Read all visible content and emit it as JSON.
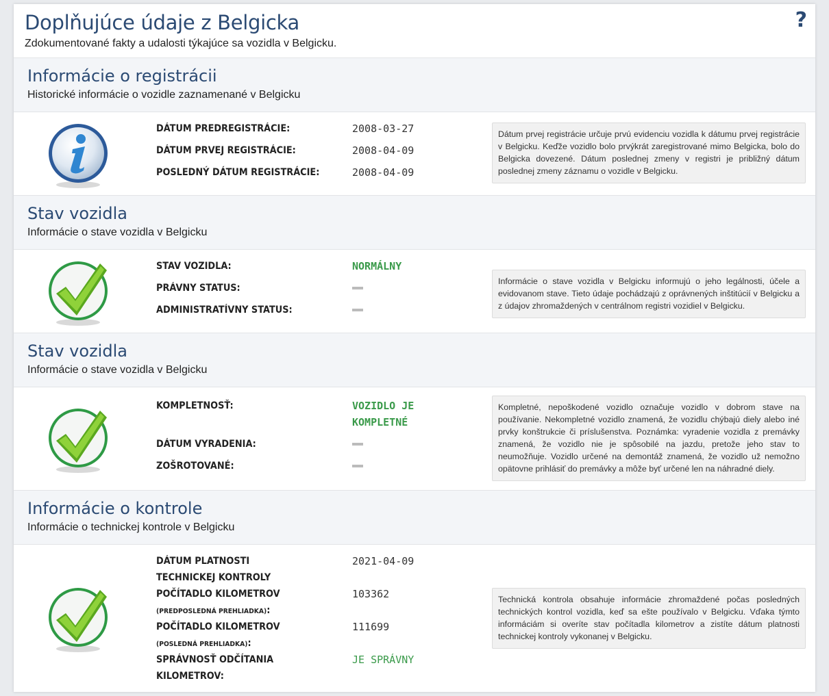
{
  "header": {
    "title": "Doplňujúce údaje z Belgicka",
    "subtitle": "Zdokumentované fakty a udalosti týkajúce sa vozidla v Belgicku.",
    "help": "?"
  },
  "sections": [
    {
      "title": "Informácie o registrácii",
      "subtitle": "Historické informácie o vozidle zaznamenané v Belgicku",
      "icon": "info-icon",
      "rows": [
        {
          "label": "DÁTUM PREDREGISTRÁCIE:",
          "value": "2008-03-27"
        },
        {
          "label": "DÁTUM PRVEJ REGISTRÁCIE:",
          "value": "2008-04-09"
        },
        {
          "label": "POSLEDNÝ DÁTUM REGISTRÁCIE:",
          "value": "2008-04-09"
        }
      ],
      "note": "Dátum prvej registrácie určuje prvú evidenciu vozidla k dátumu prvej registrácie v Belgicku. Keďže vozidlo bolo prvýkrát zaregistrované mimo Belgicka, bolo do Belgicka dovezené. Dátum poslednej zmeny v registri je približný dátum poslednej zmeny záznamu o vozidle v Belgicku."
    },
    {
      "title": "Stav vozidla",
      "subtitle": "Informácie o stave vozidla v Belgicku",
      "icon": "checkmark-icon",
      "rows": [
        {
          "label": "STAV VOZIDLA:",
          "value": "NORMÁLNY"
        },
        {
          "label": "PRÁVNY STATUS:",
          "value": ""
        },
        {
          "label": "ADMINISTRATÍVNY STATUS:",
          "value": ""
        }
      ],
      "note": "Informácie o stave vozidla v Belgicku informujú o jeho legálnosti, účele a evidovanom stave. Tieto údaje pochádzajú z oprávnených inštitúcií v Belgicku a z údajov zhromaždených v centrálnom registri vozidiel v Belgicku."
    },
    {
      "title": "Stav vozidla",
      "subtitle": "Informácie o stave vozidla v Belgicku",
      "icon": "checkmark-icon",
      "rows": [
        {
          "label": "KOMPLETNOSŤ:",
          "value": "VOZIDLO JE KOMPLETNÉ"
        },
        {
          "label": "DÁTUM VYRADENIA:",
          "value": ""
        },
        {
          "label": "ZOŠROTOVANÉ:",
          "value": ""
        }
      ],
      "note": "Kompletné, nepoškodené vozidlo označuje vozidlo v dobrom stave na používanie. Nekompletné vozidlo znamená, že vozidlu chýbajú diely alebo iné prvky konštrukcie či príslušenstva. Poznámka: vyradenie vozidla z premávky znamená, že vozidlo nie je spôsobilé na jazdu, pretože jeho stav to neumožňuje. Vozidlo určené na demontáž znamená, že vozidlo už nemožno opätovne prihlásiť do premávky a môže byť určené len na náhradné diely."
    },
    {
      "title": "Informácie o kontrole",
      "subtitle": "Informácie o technickej kontrole v Belgicku",
      "icon": "checkmark-icon",
      "rows": [
        {
          "label": "DÁTUM PLATNOSTI TECHNICKEJ KONTROLY",
          "value": "2021-04-09"
        },
        {
          "label": "POČÍTADLO KILOMETROV",
          "label_small": "(PREDPOSLEDNÁ PREHLIADKA)",
          "label_end": ":",
          "value": "103362"
        },
        {
          "label": "POČÍTADLO KILOMETROV",
          "label_small": "(POSLEDNÁ PREHLIADKA)",
          "label_end": ":",
          "value": "111699"
        },
        {
          "label": "SPRÁVNOSŤ ODČÍTANIA KILOMETROV:",
          "value": "JE SPRÁVNY"
        }
      ],
      "note": "Technická kontrola obsahuje informácie zhromaždené počas posledných technických kontrol vozidla, keď sa ešte používalo v Belgicku. Vďaka týmto informáciám si overíte stav počítadla kilometrov a zistíte dátum platnosti technickej kontroly vykonanej v Belgicku."
    }
  ],
  "colors": {
    "heading": "#2b4a73",
    "positive": "#3a9a4a",
    "section_bg": "#f3f5f8"
  }
}
